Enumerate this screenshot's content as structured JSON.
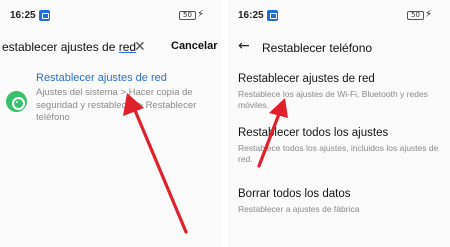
{
  "left": {
    "status": {
      "time": "16:25",
      "battery": "50"
    },
    "search": {
      "query_prefix": "establecer ajustes de ",
      "query_suffix": "red",
      "cancel_label": "Cancelar"
    },
    "result": {
      "title": "Restablecer ajustes de red",
      "path": "Ajustes del sistema > Hacer copia de seguridad y restablecer > Restablecer teléfono"
    }
  },
  "right": {
    "status": {
      "time": "16:25",
      "battery": "50"
    },
    "header": {
      "title": "Restablecer teléfono"
    },
    "options": [
      {
        "title": "Restablecer ajustes de red",
        "description": "Restablece los ajustes de Wi-Fi, Bluetooth y redes móviles."
      },
      {
        "title": "Restablecer todos los ajustes",
        "description": "Restablece todos los ajustes, incluidos los ajustes de red."
      },
      {
        "title": "Borrar todos los datos",
        "description": "Restablecer a ajustes de fábrica"
      }
    ]
  },
  "colors": {
    "accent": "#2c6fc9",
    "annotation_arrow": "#e0202a",
    "result_icon": "#37c16b"
  },
  "icons": [
    "clear-icon",
    "back-icon",
    "settings-icon",
    "charging-icon"
  ]
}
